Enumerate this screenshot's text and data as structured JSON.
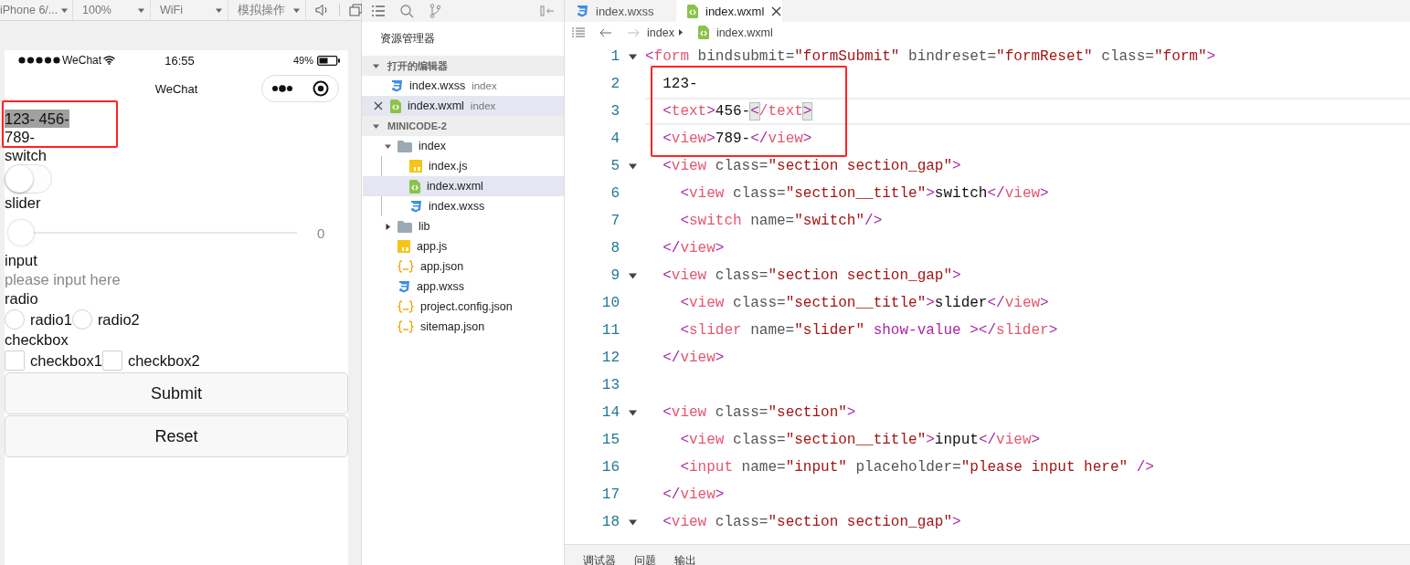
{
  "simulator": {
    "toolbar": [
      {
        "label": "iPhone 6/..."
      },
      {
        "label": "100%"
      },
      {
        "label": "WiFi"
      },
      {
        "label": "模拟操作"
      }
    ],
    "phone": {
      "status": {
        "carrier": "WeChat",
        "time": "16:55",
        "battery": "49%"
      },
      "nav_title": "WeChat",
      "items": [
        {
          "kind": "highlight_group",
          "items": [
            {
              "kind": "text",
              "text": "123- 456-",
              "selected": true
            },
            {
              "kind": "text",
              "text": "789-",
              "selected": false
            }
          ]
        },
        {
          "kind": "label",
          "text": "switch"
        },
        {
          "kind": "switch",
          "on": false
        },
        {
          "kind": "label",
          "text": "slider"
        },
        {
          "kind": "slider",
          "level": 0,
          "reading": "0"
        },
        {
          "kind": "label",
          "text": "input"
        },
        {
          "kind": "input",
          "placeholder": "please input here"
        },
        {
          "kind": "label",
          "text": "radio"
        },
        {
          "kind": "radios",
          "options": [
            {
              "label": "radio1",
              "selected": false
            },
            {
              "label": "radio2",
              "selected": false
            }
          ]
        },
        {
          "kind": "label",
          "text": "checkbox"
        },
        {
          "kind": "checkboxes",
          "options": [
            {
              "label": "checkbox1",
              "checked": false
            },
            {
              "label": "checkbox2",
              "checked": false
            }
          ]
        },
        {
          "kind": "button",
          "text": "Submit"
        },
        {
          "kind": "button",
          "text": "Reset"
        }
      ]
    }
  },
  "explorer": {
    "title": "资源管理器",
    "sections": [
      {
        "label": "打开的编辑器",
        "expanded": true,
        "items": [
          {
            "name": "index.wxss",
            "kind": "wxss",
            "detail": "index",
            "selected": false,
            "closable": false
          },
          {
            "name": "index.wxml",
            "kind": "wxml",
            "detail": "index",
            "selected": true,
            "closable": true
          }
        ]
      },
      {
        "label": "MINICODE-2",
        "expanded": true,
        "items": [
          {
            "name": "index",
            "kind": "folder",
            "expanded": true,
            "selected": false,
            "children": [
              {
                "name": "index.js",
                "kind": "js",
                "selected": false
              },
              {
                "name": "index.wxml",
                "kind": "wxml",
                "selected": true
              },
              {
                "name": "index.wxss",
                "kind": "wxss",
                "selected": false
              }
            ]
          },
          {
            "name": "lib",
            "kind": "folder",
            "expanded": false,
            "selected": false
          },
          {
            "name": "app.js",
            "kind": "js",
            "selected": false
          },
          {
            "name": "app.json",
            "kind": "json",
            "selected": false
          },
          {
            "name": "app.wxss",
            "kind": "wxss",
            "selected": false
          },
          {
            "name": "project.config.json",
            "kind": "json",
            "selected": false
          },
          {
            "name": "sitemap.json",
            "kind": "json",
            "selected": false
          }
        ]
      }
    ]
  },
  "editor": {
    "tabs": [
      {
        "label": "index.wxss",
        "kind": "wxss",
        "selected": false
      },
      {
        "label": "index.wxml",
        "kind": "wxml",
        "selected": true
      }
    ],
    "breadcrumb": {
      "folder": "index",
      "file": "index.wxml"
    },
    "lines": [
      {
        "number": "1",
        "expanded": true,
        "tokens": [
          {
            "kind": "punct",
            "text": "<"
          },
          {
            "kind": "tag",
            "text": "form"
          },
          {
            "kind": "attr",
            "text": " bindsubmit="
          },
          {
            "kind": "string",
            "text": "\"formSubmit\""
          },
          {
            "kind": "attr",
            "text": " bindreset="
          },
          {
            "kind": "string",
            "text": "\"formReset\""
          },
          {
            "kind": "attr",
            "text": " class="
          },
          {
            "kind": "string",
            "text": "\"form\""
          },
          {
            "kind": "punct",
            "text": ">"
          }
        ],
        "children": [
          {
            "kind": "highlight_group",
            "lines": [
              {
                "number": "2",
                "tokens": [
                  {
                    "kind": "text",
                    "text": "123-"
                  }
                ]
              },
              {
                "number": "3",
                "current": true,
                "tokens": [
                  {
                    "kind": "punct",
                    "text": "<"
                  },
                  {
                    "kind": "tag",
                    "text": "text"
                  },
                  {
                    "kind": "punct",
                    "text": ">"
                  },
                  {
                    "kind": "text",
                    "text": "456-"
                  },
                  {
                    "kind": "match",
                    "text": "<"
                  },
                  {
                    "kind": "tag",
                    "text": "/text"
                  },
                  {
                    "kind": "match",
                    "text": ">"
                  }
                ]
              },
              {
                "number": "4",
                "tokens": [
                  {
                    "kind": "punct",
                    "text": "<"
                  },
                  {
                    "kind": "tag",
                    "text": "view"
                  },
                  {
                    "kind": "punct",
                    "text": ">"
                  },
                  {
                    "kind": "text",
                    "text": "789-"
                  },
                  {
                    "kind": "punct",
                    "text": "</"
                  },
                  {
                    "kind": "tag",
                    "text": "view"
                  },
                  {
                    "kind": "punct",
                    "text": ">"
                  }
                ]
              }
            ]
          },
          {
            "number": "5",
            "expanded": true,
            "tokens": [
              {
                "kind": "punct",
                "text": "<"
              },
              {
                "kind": "tag",
                "text": "view"
              },
              {
                "kind": "attr",
                "text": " class="
              },
              {
                "kind": "string",
                "text": "\"section section_gap\""
              },
              {
                "kind": "punct",
                "text": ">"
              }
            ],
            "children": [
              {
                "number": "6",
                "tokens": [
                  {
                    "kind": "punct",
                    "text": "<"
                  },
                  {
                    "kind": "tag",
                    "text": "view"
                  },
                  {
                    "kind": "attr",
                    "text": " class="
                  },
                  {
                    "kind": "string",
                    "text": "\"section__title\""
                  },
                  {
                    "kind": "punct",
                    "text": ">"
                  },
                  {
                    "kind": "text",
                    "text": "switch"
                  },
                  {
                    "kind": "punct",
                    "text": "</"
                  },
                  {
                    "kind": "tag",
                    "text": "view"
                  },
                  {
                    "kind": "punct",
                    "text": ">"
                  }
                ]
              },
              {
                "number": "7",
                "tokens": [
                  {
                    "kind": "punct",
                    "text": "<"
                  },
                  {
                    "kind": "tag",
                    "text": "switch"
                  },
                  {
                    "kind": "attr",
                    "text": " name="
                  },
                  {
                    "kind": "string",
                    "text": "\"switch\""
                  },
                  {
                    "kind": "punct",
                    "text": "/>"
                  }
                ]
              }
            ]
          },
          {
            "number": "8",
            "tokens": [
              {
                "kind": "punct",
                "text": "</"
              },
              {
                "kind": "tag",
                "text": "view"
              },
              {
                "kind": "punct",
                "text": ">"
              }
            ]
          },
          {
            "number": "9",
            "expanded": true,
            "tokens": [
              {
                "kind": "punct",
                "text": "<"
              },
              {
                "kind": "tag",
                "text": "view"
              },
              {
                "kind": "attr",
                "text": " class="
              },
              {
                "kind": "string",
                "text": "\"section section_gap\""
              },
              {
                "kind": "punct",
                "text": ">"
              }
            ],
            "children": [
              {
                "number": "10",
                "tokens": [
                  {
                    "kind": "punct",
                    "text": "<"
                  },
                  {
                    "kind": "tag",
                    "text": "view"
                  },
                  {
                    "kind": "attr",
                    "text": " class="
                  },
                  {
                    "kind": "string",
                    "text": "\"section__title\""
                  },
                  {
                    "kind": "punct",
                    "text": ">"
                  },
                  {
                    "kind": "text",
                    "text": "slider"
                  },
                  {
                    "kind": "punct",
                    "text": "</"
                  },
                  {
                    "kind": "tag",
                    "text": "view"
                  },
                  {
                    "kind": "punct",
                    "text": ">"
                  }
                ]
              },
              {
                "number": "11",
                "tokens": [
                  {
                    "kind": "punct",
                    "text": "<"
                  },
                  {
                    "kind": "tag",
                    "text": "slider"
                  },
                  {
                    "kind": "attr",
                    "text": " name="
                  },
                  {
                    "kind": "string",
                    "text": "\"slider\""
                  },
                  {
                    "kind": "keyword",
                    "text": " show-value "
                  },
                  {
                    "kind": "punct",
                    "text": "></"
                  },
                  {
                    "kind": "tag",
                    "text": "slider"
                  },
                  {
                    "kind": "punct",
                    "text": ">"
                  }
                ]
              }
            ]
          },
          {
            "number": "12",
            "tokens": [
              {
                "kind": "punct",
                "text": "</"
              },
              {
                "kind": "tag",
                "text": "view"
              },
              {
                "kind": "punct",
                "text": ">"
              }
            ]
          },
          {
            "number": "13"
          },
          {
            "number": "14",
            "expanded": true,
            "tokens": [
              {
                "kind": "punct",
                "text": "<"
              },
              {
                "kind": "tag",
                "text": "view"
              },
              {
                "kind": "attr",
                "text": " class="
              },
              {
                "kind": "string",
                "text": "\"section\""
              },
              {
                "kind": "punct",
                "text": ">"
              }
            ],
            "children": [
              {
                "number": "15",
                "tokens": [
                  {
                    "kind": "punct",
                    "text": "<"
                  },
                  {
                    "kind": "tag",
                    "text": "view"
                  },
                  {
                    "kind": "attr",
                    "text": " class="
                  },
                  {
                    "kind": "string",
                    "text": "\"section__title\""
                  },
                  {
                    "kind": "punct",
                    "text": ">"
                  },
                  {
                    "kind": "text",
                    "text": "input"
                  },
                  {
                    "kind": "punct",
                    "text": "</"
                  },
                  {
                    "kind": "tag",
                    "text": "view"
                  },
                  {
                    "kind": "punct",
                    "text": ">"
                  }
                ]
              },
              {
                "number": "16",
                "tokens": [
                  {
                    "kind": "punct",
                    "text": "<"
                  },
                  {
                    "kind": "tag",
                    "text": "input"
                  },
                  {
                    "kind": "attr",
                    "text": " name="
                  },
                  {
                    "kind": "string",
                    "text": "\"input\""
                  },
                  {
                    "kind": "attr",
                    "text": " placeholder="
                  },
                  {
                    "kind": "string",
                    "text": "\"please input here\""
                  },
                  {
                    "kind": "punct",
                    "text": " />"
                  }
                ]
              }
            ]
          },
          {
            "number": "17",
            "tokens": [
              {
                "kind": "punct",
                "text": "</"
              },
              {
                "kind": "tag",
                "text": "view"
              },
              {
                "kind": "punct",
                "text": ">"
              }
            ]
          },
          {
            "number": "18",
            "expanded": true,
            "tokens": [
              {
                "kind": "punct",
                "text": "<"
              },
              {
                "kind": "tag",
                "text": "view"
              },
              {
                "kind": "attr",
                "text": " class="
              },
              {
                "kind": "string",
                "text": "\"section section_gap\""
              },
              {
                "kind": "punct",
                "text": ">"
              }
            ]
          }
        ]
      }
    ]
  },
  "bottom_panel": {
    "tabs": [
      {
        "label": "调试器"
      },
      {
        "label": "问题"
      },
      {
        "label": "输出"
      }
    ]
  }
}
